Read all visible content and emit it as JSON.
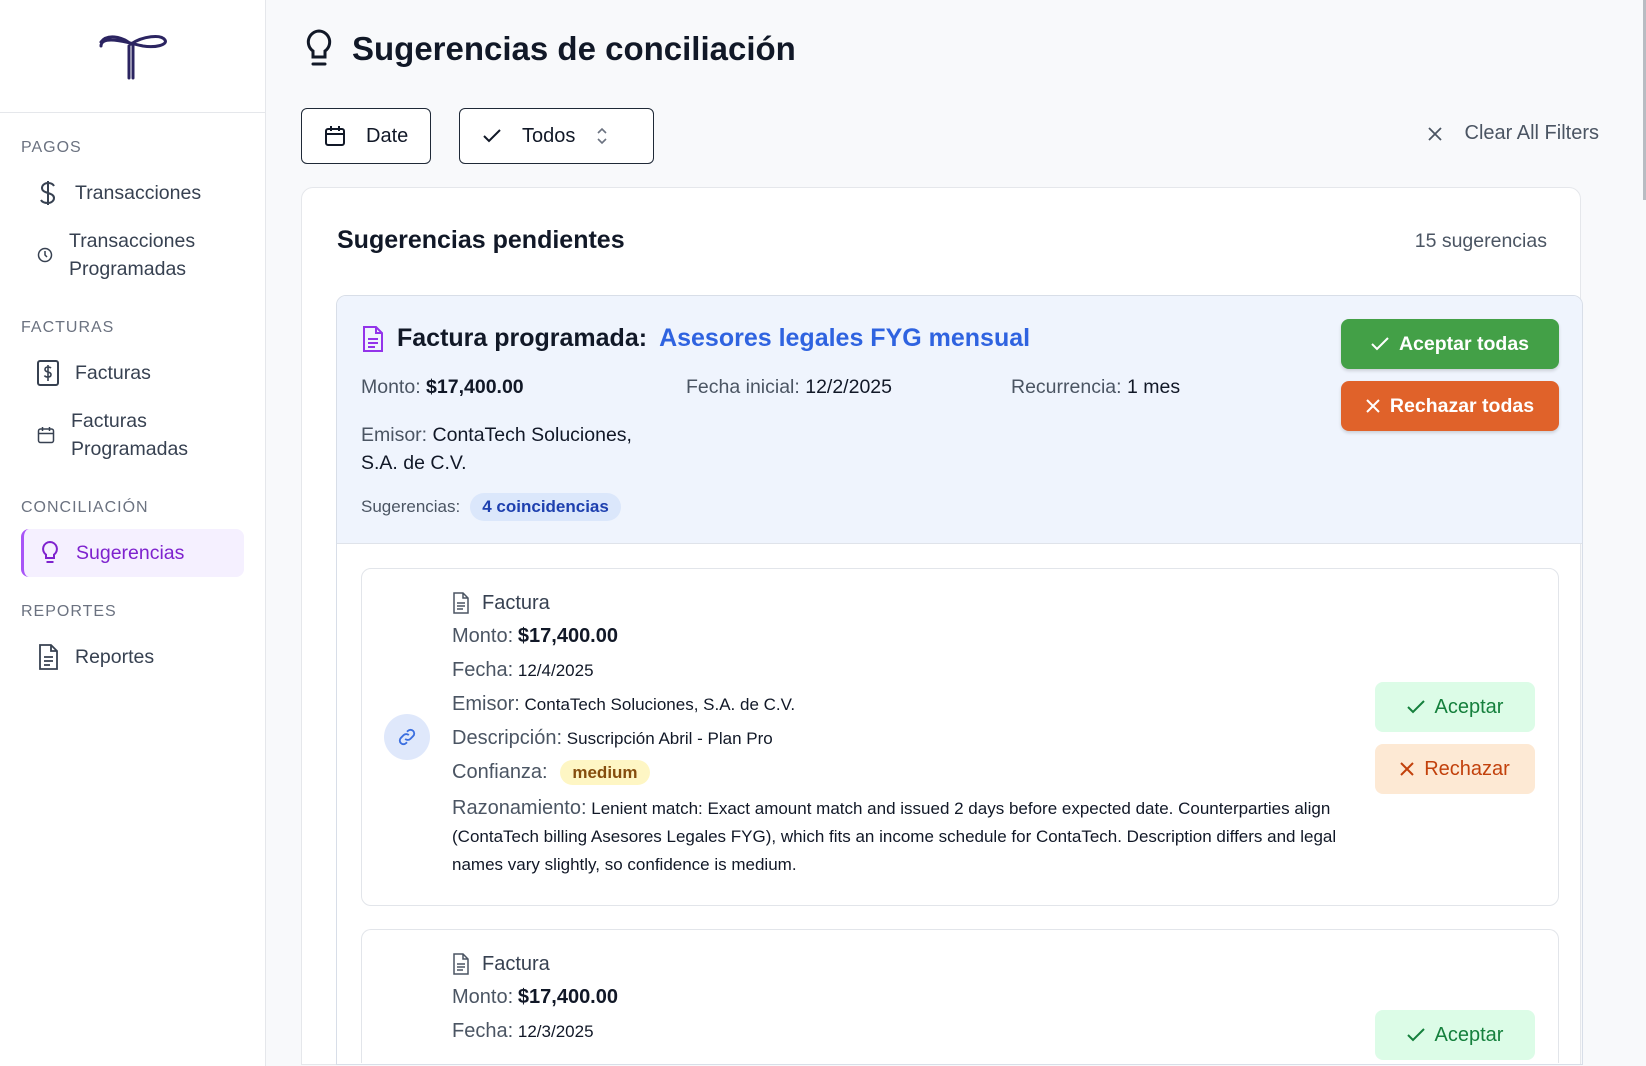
{
  "sidebar": {
    "sections": [
      {
        "label": "PAGOS",
        "items": [
          {
            "label": "Transacciones",
            "icon": "dollar-icon"
          },
          {
            "label": "Transacciones Programadas",
            "icon": "clock-icon"
          }
        ]
      },
      {
        "label": "FACTURAS",
        "items": [
          {
            "label": "Facturas",
            "icon": "invoice-dollar-icon"
          },
          {
            "label": "Facturas Programadas",
            "icon": "calendar-icon"
          }
        ]
      },
      {
        "label": "CONCILIACIÓN",
        "items": [
          {
            "label": "Sugerencias",
            "icon": "lightbulb-icon",
            "active": true
          }
        ]
      },
      {
        "label": "REPORTES",
        "items": [
          {
            "label": "Reportes",
            "icon": "document-icon"
          }
        ]
      }
    ]
  },
  "header": {
    "title": "Sugerencias de conciliación"
  },
  "filters": {
    "date_label": "Date",
    "status_label": "Todos",
    "clear_label": "Clear All Filters"
  },
  "panel": {
    "title": "Sugerencias pendientes",
    "count": "15 sugerencias"
  },
  "group": {
    "title_prefix": "Factura programada:",
    "title_link": "Asesores legales FYG mensual",
    "monto_label": "Monto:",
    "monto": "$17,400.00",
    "fecha_label": "Fecha inicial:",
    "fecha": "12/2/2025",
    "recurrencia_label": "Recurrencia:",
    "recurrencia": "1 mes",
    "emisor_label": "Emisor:",
    "emisor": "ContaTech Soluciones, S.A. de C.V.",
    "sugerencias_label": "Sugerencias:",
    "coincidencias": "4 coincidencias",
    "accept_all": "Aceptar todas",
    "reject_all": "Rechazar todas",
    "accent_green": "#43a047",
    "accent_orange": "#e0622a"
  },
  "suggestions": [
    {
      "type": "Factura",
      "monto_label": "Monto:",
      "monto": "$17,400.00",
      "fecha_label": "Fecha:",
      "fecha": "12/4/2025",
      "emisor_label": "Emisor:",
      "emisor": "ContaTech Soluciones, S.A. de C.V.",
      "descripcion_label": "Descripción:",
      "descripcion": "Suscripción Abril - Plan Pro",
      "confianza_label": "Confianza:",
      "confianza": "medium",
      "razonamiento_label": "Razonamiento:",
      "razonamiento": "Lenient match: Exact amount match and issued 2 days before expected date. Counterparties align (ContaTech billing Asesores Legales FYG), which fits an income schedule for ContaTech. Description differs and legal names vary slightly, so confidence is medium.",
      "accept": "Aceptar",
      "reject": "Rechazar"
    },
    {
      "type": "Factura",
      "monto_label": "Monto:",
      "monto": "$17,400.00",
      "fecha_label": "Fecha:",
      "fecha": "12/3/2025",
      "accept": "Aceptar"
    }
  ]
}
